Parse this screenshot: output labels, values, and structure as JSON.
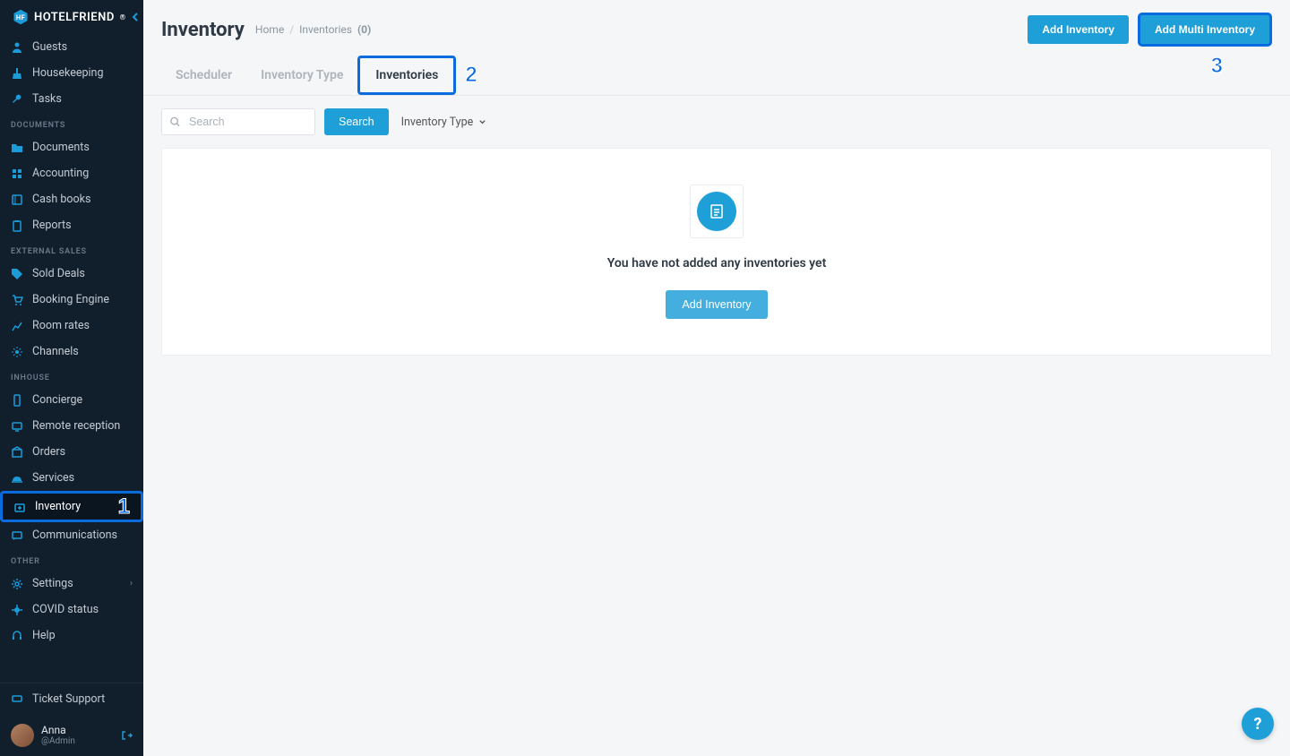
{
  "brand": "HOTELFRIEND",
  "brand_suffix": "®",
  "sidebar": {
    "top": [
      {
        "icon": "user-icon",
        "label": "Guests"
      },
      {
        "icon": "broom-icon",
        "label": "Housekeeping"
      },
      {
        "icon": "wrench-icon",
        "label": "Tasks"
      }
    ],
    "sections": [
      {
        "label": "DOCUMENTS",
        "items": [
          {
            "icon": "folder-icon",
            "label": "Documents"
          },
          {
            "icon": "calc-icon",
            "label": "Accounting"
          },
          {
            "icon": "book-icon",
            "label": "Cash books"
          },
          {
            "icon": "clipboard-icon",
            "label": "Reports"
          }
        ]
      },
      {
        "label": "EXTERNAL SALES",
        "items": [
          {
            "icon": "tag-icon",
            "label": "Sold Deals"
          },
          {
            "icon": "cart-icon",
            "label": "Booking Engine"
          },
          {
            "icon": "chart-icon",
            "label": "Room rates"
          },
          {
            "icon": "sparkle-icon",
            "label": "Channels"
          }
        ]
      },
      {
        "label": "INHOUSE",
        "items": [
          {
            "icon": "tablet-icon",
            "label": "Concierge"
          },
          {
            "icon": "screen-icon",
            "label": "Remote reception"
          },
          {
            "icon": "package-icon",
            "label": "Orders"
          },
          {
            "icon": "bell-icon",
            "label": "Services"
          },
          {
            "icon": "medkit-icon",
            "label": "Inventory",
            "active": true
          },
          {
            "icon": "chat-icon",
            "label": "Communications"
          }
        ]
      },
      {
        "label": "OTHER",
        "items": [
          {
            "icon": "gear-icon",
            "label": "Settings",
            "chevron": true
          },
          {
            "icon": "virus-icon",
            "label": "COVID status"
          },
          {
            "icon": "headset-icon",
            "label": "Help"
          }
        ]
      }
    ],
    "ticket": "Ticket Support",
    "user": {
      "name": "Anna",
      "role": "@Admin"
    }
  },
  "header": {
    "title": "Inventory",
    "crumbs": {
      "home": "Home",
      "current": "Inventories",
      "count": "(0)"
    },
    "add_btn": "Add Inventory",
    "add_multi_btn": "Add Multi Inventory"
  },
  "tabs": {
    "scheduler": "Scheduler",
    "type": "Inventory Type",
    "inventories": "Inventories"
  },
  "filters": {
    "search_placeholder": "Search",
    "search_btn": "Search",
    "type_dd": "Inventory Type"
  },
  "empty": {
    "message": "You have not added any inventories yet",
    "cta": "Add Inventory"
  },
  "callouts": {
    "one": "1",
    "two": "2",
    "three": "3"
  },
  "help_fab": "?"
}
